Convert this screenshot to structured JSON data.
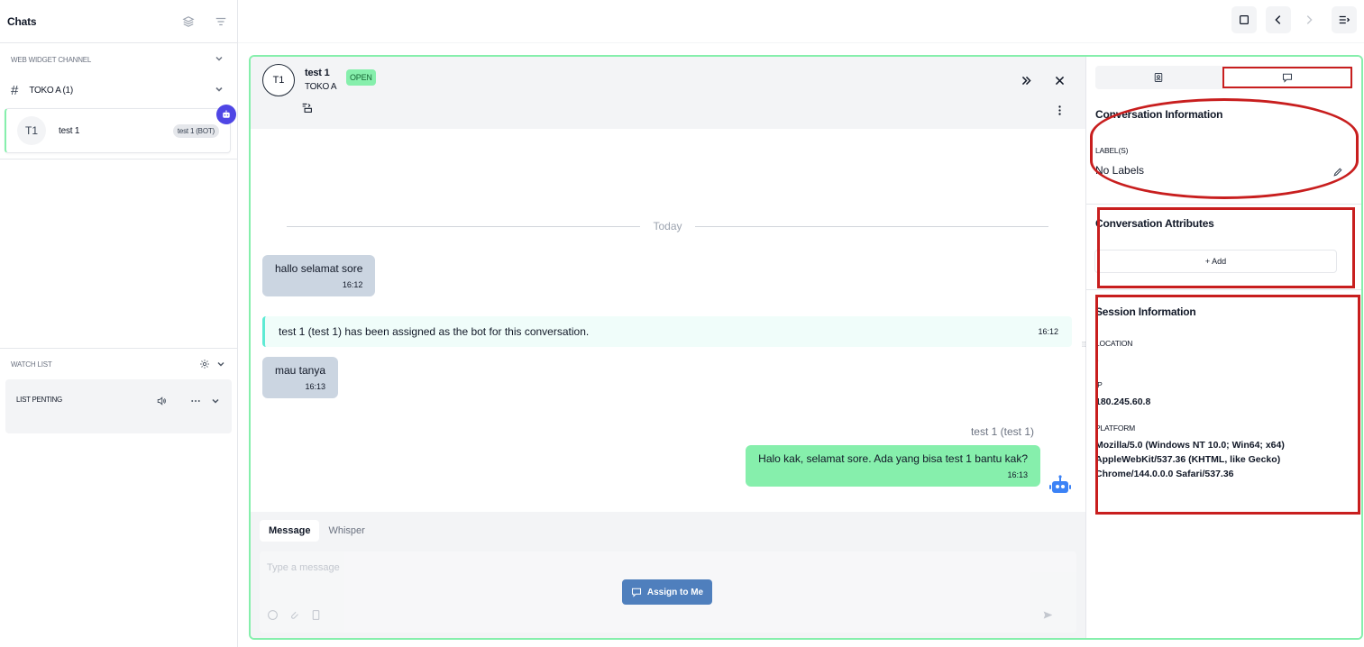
{
  "sidebar": {
    "title": "Chats",
    "section_label": "WEB WIDGET CHANNEL",
    "channel_name": "TOKO A (1)",
    "chat": {
      "avatar": "T1",
      "name": "test 1",
      "badge": "test 1 (BOT)"
    },
    "watchlist_label": "WATCH LIST",
    "watch_item": "LIST PENTING"
  },
  "conversation": {
    "avatar": "T1",
    "name": "test 1",
    "inbox": "TOKO A",
    "status": "OPEN",
    "date_separator": "Today",
    "messages": [
      {
        "text": "hallo selamat sore",
        "time": "16:12"
      },
      {
        "text": "test 1 (test 1) has been assigned as the bot for this conversation.",
        "time": "16:12"
      },
      {
        "text": "mau tanya",
        "time": "16:13"
      },
      {
        "sender": "test 1 (test 1)",
        "text": "Halo kak, selamat sore. Ada yang bisa test 1 bantu kak?",
        "time": "16:13"
      }
    ]
  },
  "composer": {
    "tab_message": "Message",
    "tab_whisper": "Whisper",
    "placeholder": "Type a message",
    "assign_label": "Assign to Me"
  },
  "details": {
    "conv_info_title": "Conversation Information",
    "labels_label": "LABEL(S)",
    "labels_value": "No Labels",
    "attributes_title": "Conversation Attributes",
    "add_label": "+ Add",
    "session_title": "Session Information",
    "location_label": "LOCATION",
    "location_value": "-",
    "ip_label": "IP",
    "ip_value": "180.245.60.8",
    "platform_label": "PLATFORM",
    "platform_value": "Mozilla/5.0 (Windows NT 10.0; Win64; x64) AppleWebKit/537.36 (KHTML, like Gecko) Chrome/144.0.0.0 Safari/537.36"
  },
  "colors": {
    "accent_green": "#86efac",
    "annotation_red": "#c81e1e",
    "primary_blue": "#4f7fbd",
    "bot_purple": "#4f46e5"
  }
}
